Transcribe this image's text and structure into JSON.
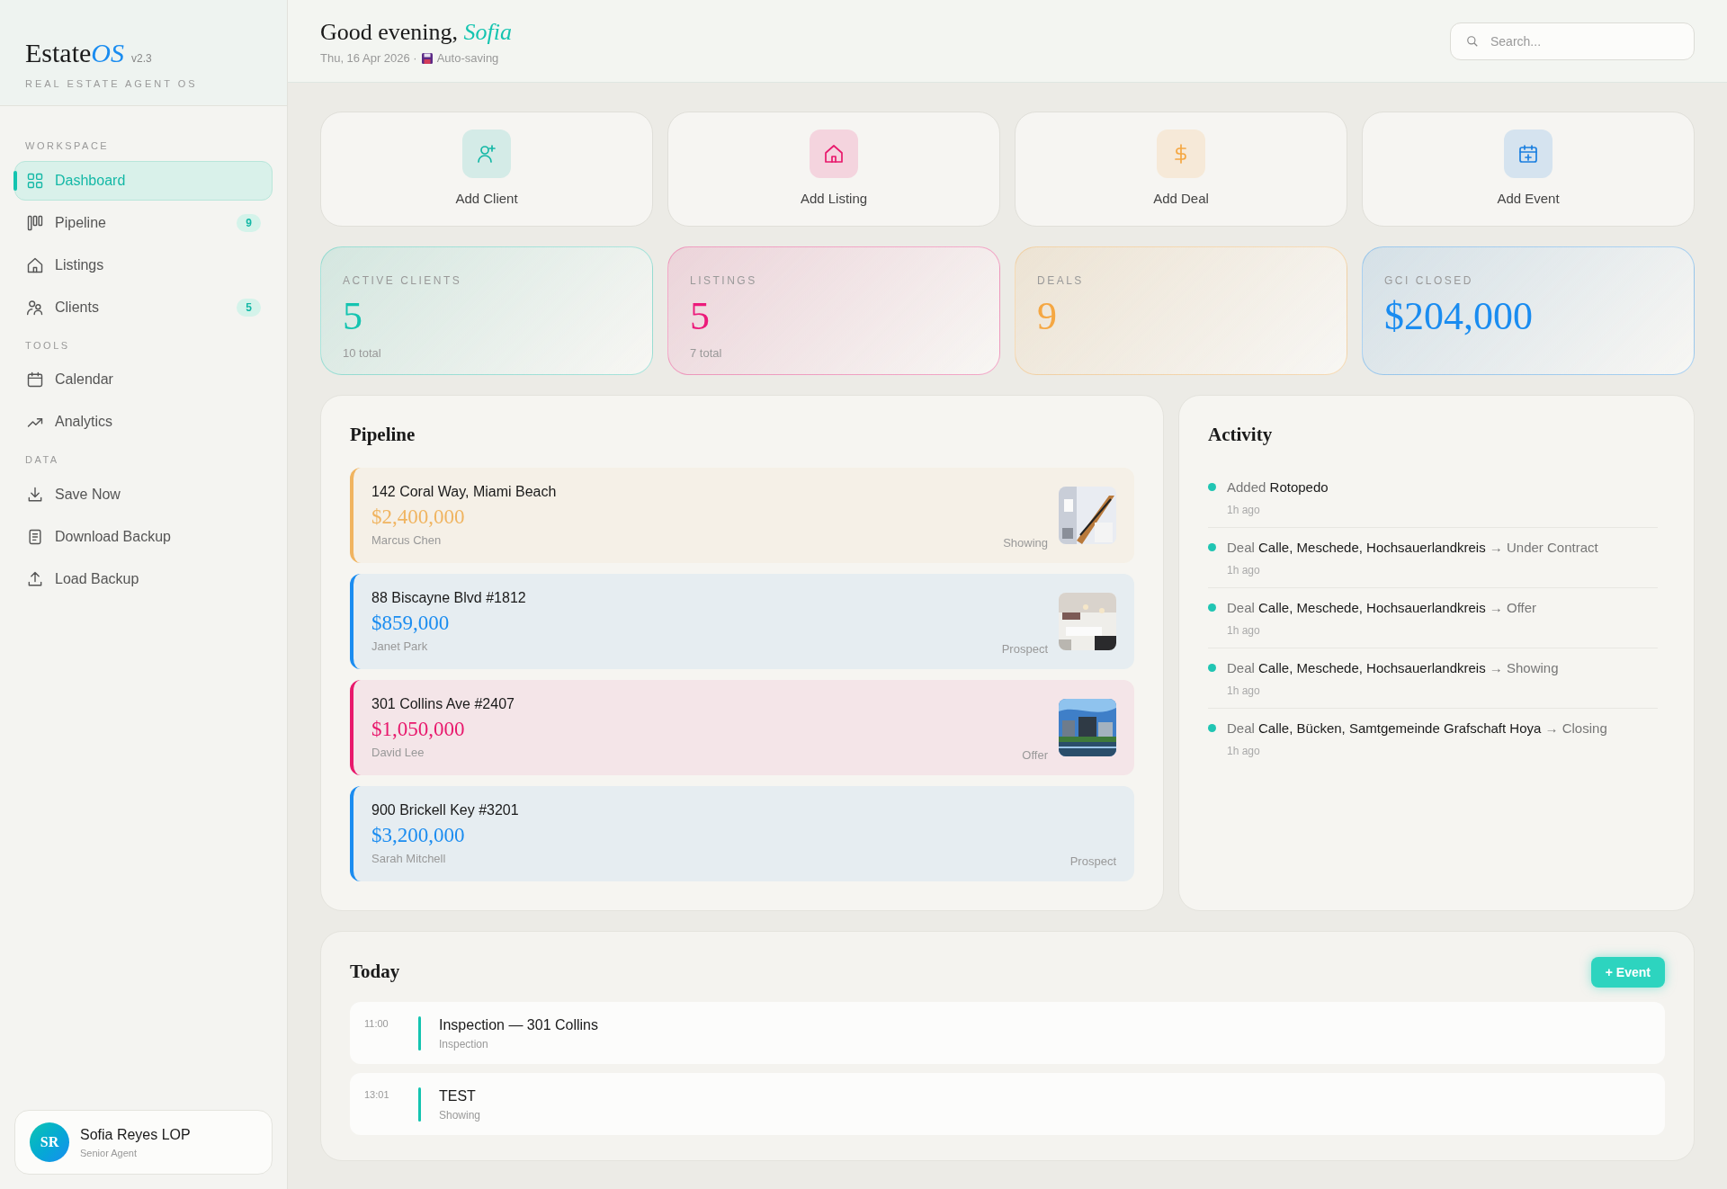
{
  "brand": {
    "name": "Estate",
    "name_accent": "OS",
    "version": "v2.3",
    "tagline": "REAL ESTATE AGENT OS"
  },
  "sidebar": {
    "sections": [
      {
        "title": "WORKSPACE",
        "items": [
          {
            "label": "Dashboard",
            "selected": true
          },
          {
            "label": "Pipeline",
            "badge": "9",
            "selected": false
          },
          {
            "label": "Listings",
            "selected": false
          },
          {
            "label": "Clients",
            "badge": "5",
            "selected": false
          }
        ]
      },
      {
        "title": "TOOLS",
        "items": [
          {
            "label": "Calendar",
            "selected": false
          },
          {
            "label": "Analytics",
            "selected": false
          }
        ]
      },
      {
        "title": "DATA",
        "items": [
          {
            "label": "Save Now",
            "selected": false
          },
          {
            "label": "Download Backup",
            "selected": false
          },
          {
            "label": "Load Backup",
            "selected": false
          }
        ]
      }
    ],
    "user": {
      "initials": "SR",
      "name": "Sofia Reyes LOP",
      "role": "Senior Agent"
    }
  },
  "header": {
    "greeting": "Good evening, *Sofia*",
    "date": "Thu, 16 Apr 2026 ·",
    "save_status": "Auto-saving",
    "search": {
      "placeholder": "Search..."
    }
  },
  "quick_actions": [
    {
      "label": "Add Client",
      "color": "#14b8a6"
    },
    {
      "label": "Add Listing",
      "color": "#e8186c"
    },
    {
      "label": "Add Deal",
      "color": "#f5a742"
    },
    {
      "label": "Add Event",
      "color": "#1a7fe0"
    }
  ],
  "stats": [
    {
      "label": "ACTIVE CLIENTS",
      "value": "5",
      "sub": "10 total",
      "color": "#14c4b0"
    },
    {
      "label": "LISTINGS",
      "value": "5",
      "sub": "7 total",
      "color": "#ec1a7a"
    },
    {
      "label": "DEALS",
      "value": "9",
      "color": "#f5a742"
    },
    {
      "label": "GCI CLOSED",
      "value": "$204,000",
      "color": "#1a8cf0"
    }
  ],
  "pipeline": {
    "title": "Pipeline",
    "deals": [
      {
        "address": "142 Coral Way, Miami Beach",
        "price": "$2,400,000",
        "client": "Marcus Chen",
        "stage": "Showing",
        "color": "#f0b460",
        "photo": true
      },
      {
        "address": "88 Biscayne Blvd #1812",
        "price": "$859,000",
        "client": "Janet Park",
        "stage": "Prospect",
        "color": "#1a8cf0",
        "photo": true
      },
      {
        "address": "301 Collins Ave #2407",
        "price": "$1,050,000",
        "client": "David Lee",
        "stage": "Offer",
        "color": "#e8186c",
        "photo": true
      },
      {
        "address": "900 Brickell Key #3201",
        "price": "$3,200,000",
        "client": "Sarah Mitchell",
        "stage": "Prospect",
        "color": "#1a8cf0",
        "photo": false
      }
    ]
  },
  "activity": {
    "title": "Activity",
    "items": [
      {
        "text": "Added **Rotopedo**",
        "time": "1h ago"
      },
      {
        "text": "Deal **Calle, Meschede, Hochsauerlandkreis** → Under Contract",
        "time": "1h ago"
      },
      {
        "text": "Deal **Calle, Meschede, Hochsauerlandkreis** → Offer",
        "time": "1h ago"
      },
      {
        "text": "Deal **Calle, Meschede, Hochsauerlandkreis** → Showing",
        "time": "1h ago"
      },
      {
        "text": "Deal **Calle, Bücken, Samtgemeinde Grafschaft Hoya** → Closing",
        "time": "1h ago"
      }
    ]
  },
  "today": {
    "title": "Today",
    "add_button": "+ Event",
    "events": [
      {
        "time": "11:00",
        "title": "Inspection — 301 Collins",
        "type": "Inspection"
      },
      {
        "time": "13:01",
        "title": "TEST",
        "type": "Showing"
      }
    ]
  }
}
